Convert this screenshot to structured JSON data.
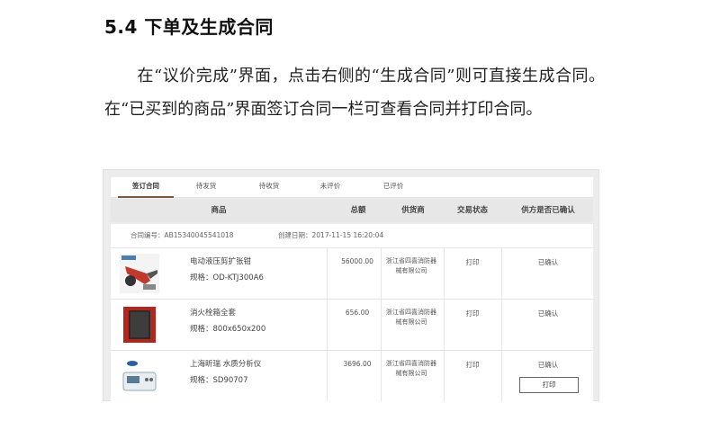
{
  "document": {
    "heading": "5.4 下单及生成合同",
    "paragraph": "在“议价完成”界面，点击右侧的“生成合同”则可直接生成合同。在“已买到的商品”界面签订合同一栏可查看合同并打印合同。"
  },
  "screenshot": {
    "tabs": [
      {
        "label": "签订合同",
        "active": true
      },
      {
        "label": "待发货",
        "active": false
      },
      {
        "label": "待收货",
        "active": false
      },
      {
        "label": "未评价",
        "active": false
      },
      {
        "label": "已评价",
        "active": false
      }
    ],
    "table_headers": {
      "product": "商品",
      "amount": "总额",
      "supplier": "供货商",
      "trade_status": "交易状态",
      "supplier_confirmed": "供方是否已确认"
    },
    "order": {
      "contract_no": "合同编号：AB15340045541018",
      "created_date": "创建日期：2017-11-15 16:20:04"
    },
    "rows": [
      {
        "name": "电动液压剪扩张钳",
        "spec": "规格：OD-KTJ300A6",
        "amount": "56000.00",
        "supplier": "浙江省四喜消防器\n械有限公司",
        "status": "打印",
        "confirmed": "已确认",
        "thumb_icon": "hydraulic-tool-icon"
      },
      {
        "name": "消火栓箱全套",
        "spec": "规格：800x650x200",
        "amount": "656.00",
        "supplier": "浙江省四喜消防器\n械有限公司",
        "status": "打印",
        "confirmed": "已确认",
        "thumb_icon": "hydrant-cabinet-icon"
      },
      {
        "name": "上海昕瑞 水质分析仪",
        "spec": "规格：SD90707",
        "amount": "3696.00",
        "supplier": "浙江省四喜消防器\n械有限公司",
        "status": "打印",
        "confirmed": "已确认",
        "thumb_icon": "water-analyzer-icon",
        "print_button": "打印"
      }
    ]
  },
  "colors": {
    "tab_active_underline": "#7b5a3b",
    "header_bg": "#e7e7e7",
    "frame_bg": "#ececec"
  }
}
